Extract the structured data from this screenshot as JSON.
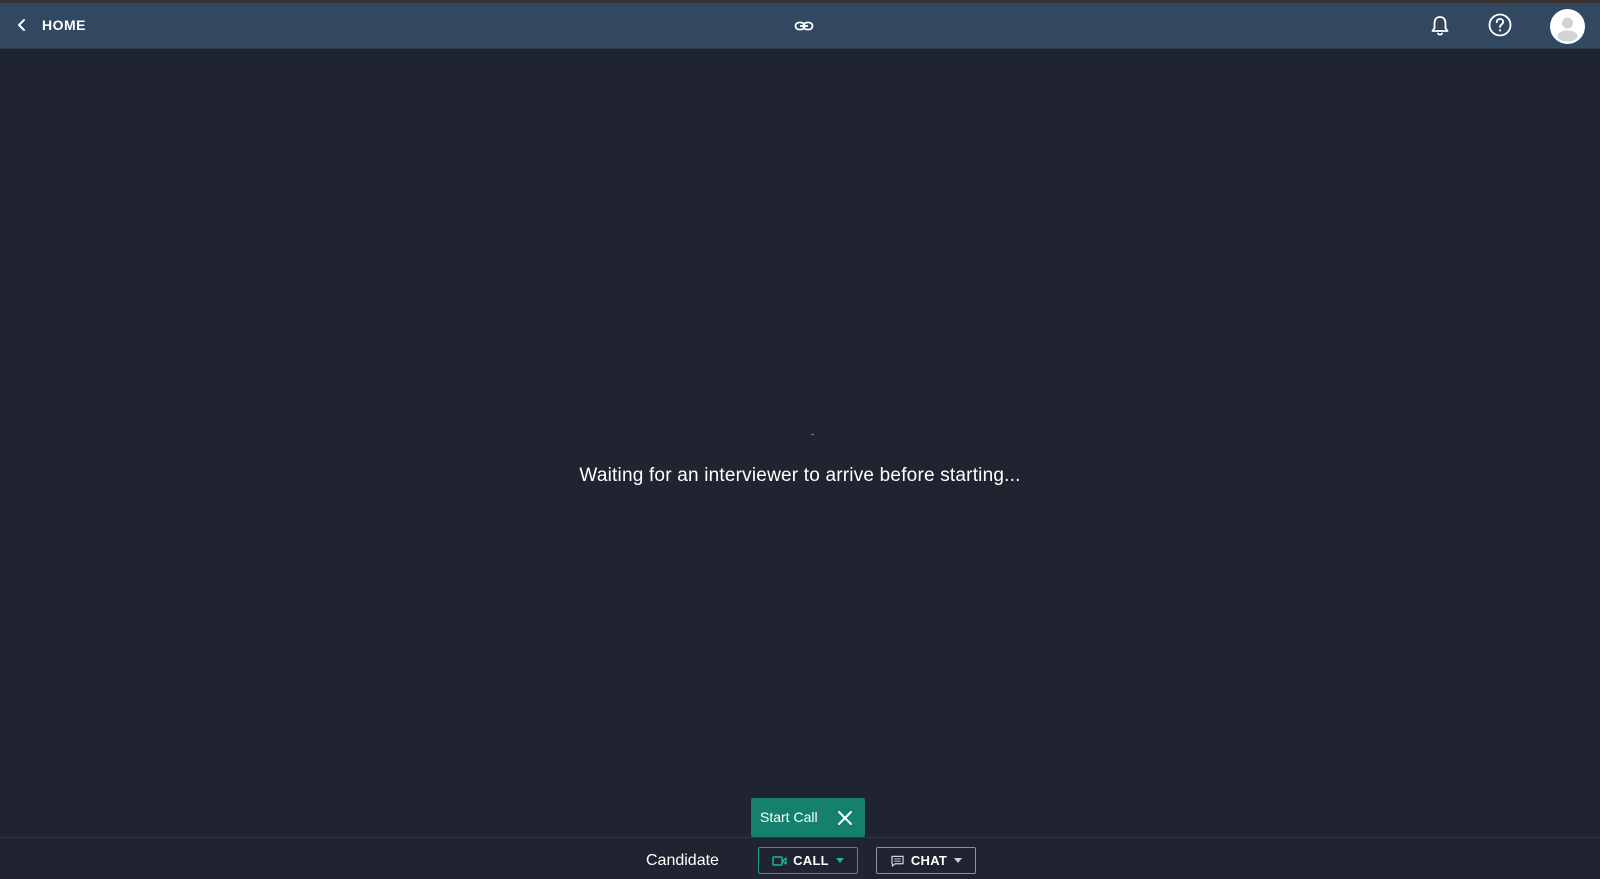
{
  "header": {
    "back_label": "HOME",
    "icons": {
      "back": "chevron-left-icon",
      "share_link": "link-icon",
      "notifications": "bell-icon",
      "help": "help-circle-icon",
      "profile": "user-avatar-icon"
    }
  },
  "main": {
    "status_message": "Waiting for an interviewer to arrive before starting..."
  },
  "tooltip": {
    "label": "Start Call",
    "close_icon": "close-icon"
  },
  "footer": {
    "participant_label": "Candidate",
    "call_button": {
      "label": "CALL",
      "icon": "video-camera-icon"
    },
    "chat_button": {
      "label": "CHAT",
      "icon": "chat-bubble-icon"
    }
  },
  "colors": {
    "header_bg": "#324760",
    "page_bg": "#1f2430",
    "accent_green": "#15806b",
    "call_border": "#1f9e89",
    "chat_border": "#8b93a3",
    "spinner": "#3d7fd6"
  }
}
